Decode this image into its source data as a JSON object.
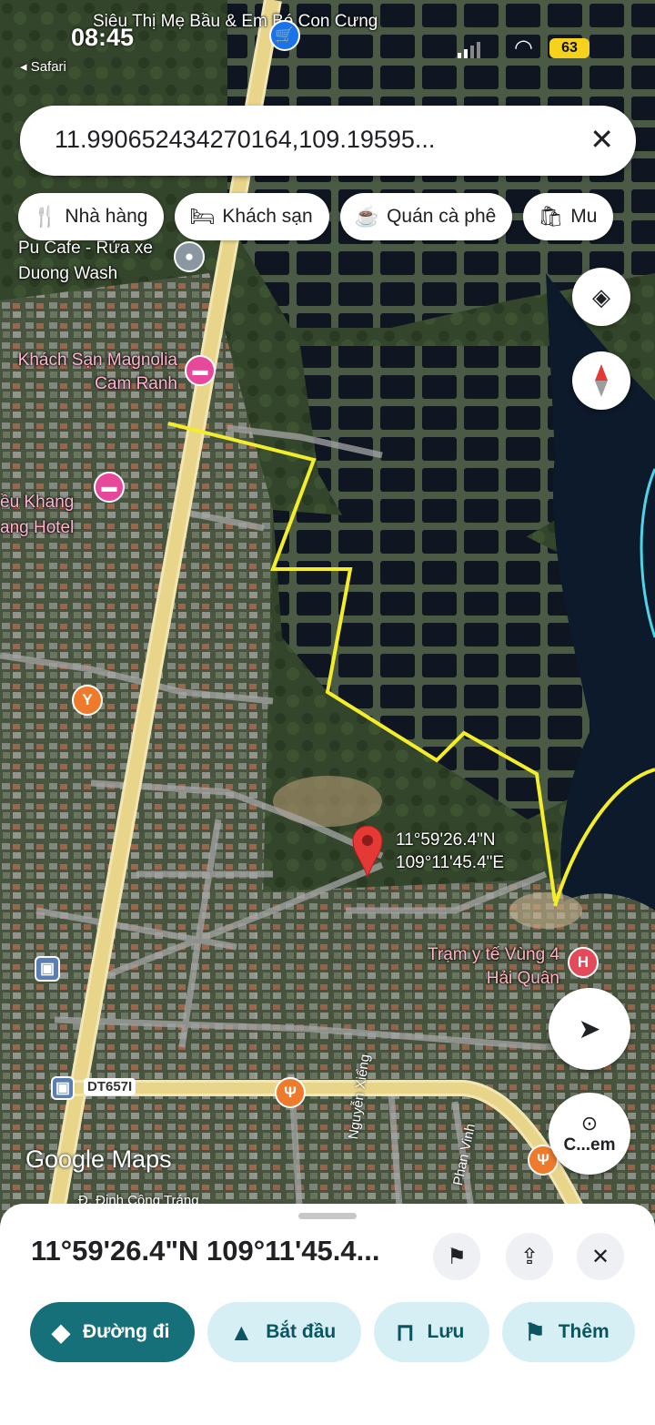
{
  "status": {
    "time": "08:45",
    "back_label": "◂ Safari",
    "battery": "63"
  },
  "search": {
    "query": "11.990652434270164,109.19595..."
  },
  "chips": [
    {
      "icon": "restaurant-icon",
      "label": "Nhà hàng"
    },
    {
      "icon": "hotel-icon",
      "label": "Khách sạn"
    },
    {
      "icon": "coffee-icon",
      "label": "Quán cà phê"
    },
    {
      "icon": "shopping-icon",
      "label": "Mu"
    }
  ],
  "map": {
    "pois": [
      {
        "name": "Siêu Thị Mẹ Bầu & Em Bé Con Cưng"
      },
      {
        "name": "Pu Cafe - Rửa xe Duong Wash"
      },
      {
        "name": "Khách Sạn Magnolia Cam Ranh"
      },
      {
        "name": "ều Khang ang Hotel"
      },
      {
        "name": "Trạm y tế Vùng 4 Hải Quân"
      }
    ],
    "pin": {
      "lat": "11°59'26.4\"N",
      "lng": "109°11'45.4\"E"
    },
    "roads": [
      "DT657I",
      "Nguyễn Xiểng",
      "Phan Vinh",
      "Đ. Đinh Công Tráng"
    ],
    "logo": "Google Maps",
    "street_view_label": "C...em",
    "boundary_color": "#f4ee2a"
  },
  "sheet": {
    "coord_title": "11°59'26.4\"N 109°11'45.4...",
    "actions": [
      {
        "icon": "directions-icon",
        "label": "Đường đi"
      },
      {
        "icon": "navigation-icon",
        "label": "Bắt đầu"
      },
      {
        "icon": "bookmark-icon",
        "label": "Lưu"
      },
      {
        "icon": "flag-icon",
        "label": "Thêm"
      }
    ]
  }
}
